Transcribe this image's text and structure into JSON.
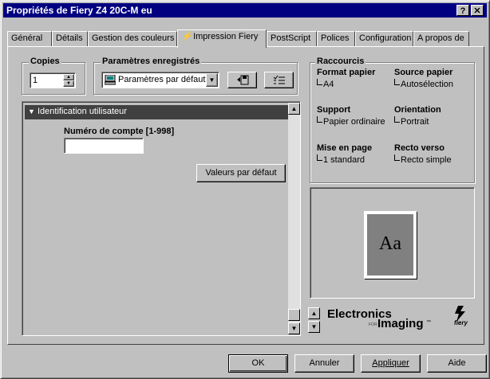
{
  "window": {
    "title": "Propriétés de Fiery Z4 20C-M eu",
    "help_btn": "?",
    "close_btn": "✕"
  },
  "tabs": [
    {
      "label": "Général"
    },
    {
      "label": "Détails"
    },
    {
      "label": "Gestion des couleurs"
    },
    {
      "label": "Impression Fiery",
      "icon": "fiery-icon",
      "active": true
    },
    {
      "label": "PostScript"
    },
    {
      "label": "Polices"
    },
    {
      "label": "Configuration"
    },
    {
      "label": "A propos de"
    }
  ],
  "copies": {
    "label": "Copies",
    "value": "1"
  },
  "saved_settings": {
    "label": "Paramètres enregistrés",
    "selected": "Paramètres par défaut",
    "icon": "computer-icon"
  },
  "section": {
    "header": "Identification utilisateur",
    "account_label": "Numéro de compte [1-998]",
    "account_value": "",
    "defaults_button": "Valeurs par défaut"
  },
  "shortcuts": {
    "title": "Raccourcis",
    "items": [
      {
        "label": "Format papier",
        "value": "A4"
      },
      {
        "label": "Source papier",
        "value": "Autosélection"
      },
      {
        "label": "Support",
        "value": "Papier ordinaire"
      },
      {
        "label": "Orientation",
        "value": "Portrait"
      },
      {
        "label": "Mise en page",
        "value": "1 standard"
      },
      {
        "label": "Recto verso",
        "value": "Recto simple"
      }
    ]
  },
  "preview": {
    "text": "Aa"
  },
  "brand": {
    "line1": "Electronics",
    "for": "FOR",
    "line2": "Imaging",
    "tm": "™",
    "logo_text": "fiery"
  },
  "buttons": {
    "ok": "OK",
    "cancel": "Annuler",
    "apply": "Appliquer",
    "help": "Aide"
  },
  "colors": {
    "title_bar": "#000080",
    "section_header": "#404040",
    "preview_page": "#808080"
  }
}
